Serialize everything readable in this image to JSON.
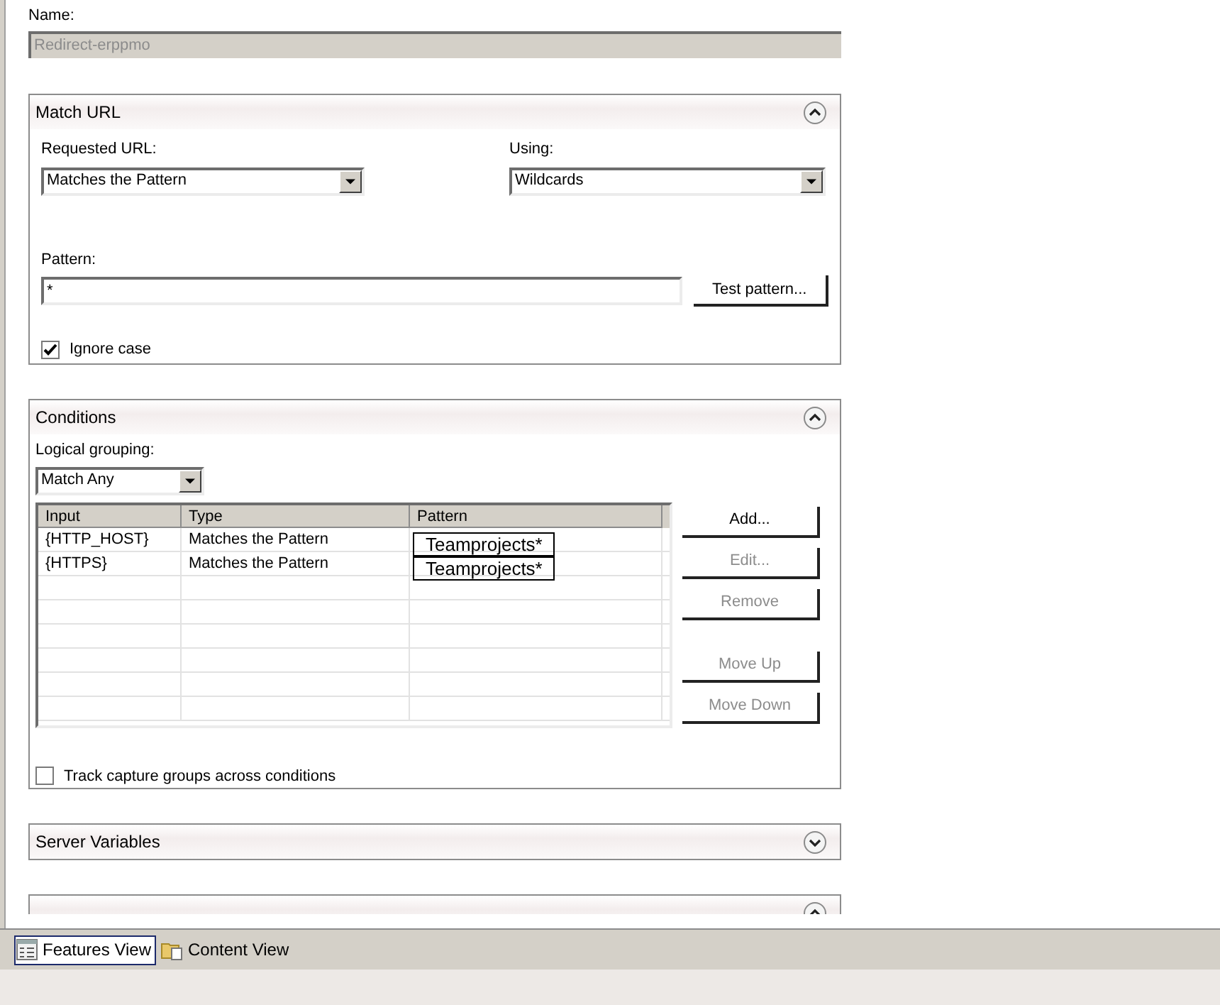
{
  "name_field": {
    "label": "Name:",
    "value": "Redirect-erppmo",
    "disabled": true
  },
  "match_url": {
    "title": "Match URL",
    "expanded": true,
    "requested_url": {
      "label": "Requested URL:",
      "value": "Matches the Pattern"
    },
    "using": {
      "label": "Using:",
      "value": "Wildcards"
    },
    "pattern": {
      "label": "Pattern:",
      "value": "*"
    },
    "test_button": "Test pattern...",
    "ignore_case": {
      "label": "Ignore case",
      "checked": true
    }
  },
  "conditions": {
    "title": "Conditions",
    "expanded": true,
    "logical_grouping": {
      "label": "Logical grouping:",
      "value": "Match Any"
    },
    "table": {
      "columns": [
        "Input",
        "Type",
        "Pattern"
      ],
      "rows": [
        {
          "input": "{HTTP_HOST}",
          "type": "Matches the Pattern",
          "pattern": "Teamprojects*"
        },
        {
          "input": "{HTTPS}",
          "type": "Matches the Pattern",
          "pattern": "Teamprojects*"
        }
      ]
    },
    "buttons": [
      {
        "label": "Add...",
        "disabled": false
      },
      {
        "label": "Edit...",
        "disabled": true
      },
      {
        "label": "Remove",
        "disabled": true
      },
      {
        "label": "Move Up",
        "disabled": true
      },
      {
        "label": "Move Down",
        "disabled": true
      }
    ],
    "track_capture": {
      "label": "Track capture groups across conditions",
      "checked": false
    }
  },
  "server_variables": {
    "title": "Server Variables",
    "expanded": false
  },
  "action_panel": {
    "expanded": true
  },
  "bottom_tabs": [
    {
      "label": "Features View",
      "selected": true
    },
    {
      "label": "Content View",
      "selected": false
    }
  ]
}
